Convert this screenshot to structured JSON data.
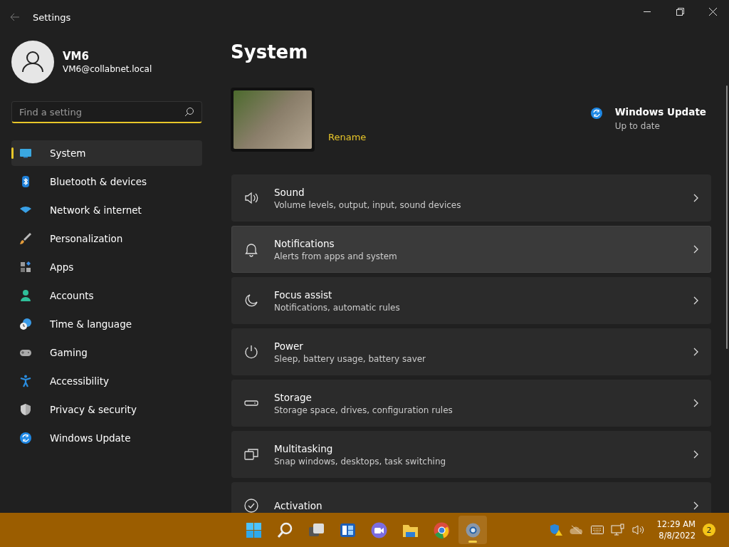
{
  "window": {
    "title": "Settings"
  },
  "profile": {
    "name": "VM6",
    "email": "VM6@collabnet.local"
  },
  "search": {
    "placeholder": "Find a setting"
  },
  "sidebar": {
    "items": [
      {
        "label": "System",
        "selected": true
      },
      {
        "label": "Bluetooth & devices",
        "selected": false
      },
      {
        "label": "Network & internet",
        "selected": false
      },
      {
        "label": "Personalization",
        "selected": false
      },
      {
        "label": "Apps",
        "selected": false
      },
      {
        "label": "Accounts",
        "selected": false
      },
      {
        "label": "Time & language",
        "selected": false
      },
      {
        "label": "Gaming",
        "selected": false
      },
      {
        "label": "Accessibility",
        "selected": false
      },
      {
        "label": "Privacy & security",
        "selected": false
      },
      {
        "label": "Windows Update",
        "selected": false
      }
    ]
  },
  "page": {
    "title": "System",
    "rename": "Rename",
    "update": {
      "title": "Windows Update",
      "status": "Up to date"
    }
  },
  "cards": [
    {
      "title": "Sound",
      "description": "Volume levels, output, input, sound devices",
      "hovered": false
    },
    {
      "title": "Notifications",
      "description": "Alerts from apps and system",
      "hovered": true
    },
    {
      "title": "Focus assist",
      "description": "Notifications, automatic rules",
      "hovered": false
    },
    {
      "title": "Power",
      "description": "Sleep, battery usage, battery saver",
      "hovered": false
    },
    {
      "title": "Storage",
      "description": "Storage space, drives, configuration rules",
      "hovered": false
    },
    {
      "title": "Multitasking",
      "description": "Snap windows, desktops, task switching",
      "hovered": false
    },
    {
      "title": "Activation",
      "hovered": false
    }
  ],
  "taskbar": {
    "apps": [
      {
        "kind": "start",
        "active": false
      },
      {
        "kind": "search",
        "active": false
      },
      {
        "kind": "taskview",
        "active": false
      },
      {
        "kind": "widgets",
        "active": false
      },
      {
        "kind": "chat",
        "active": false
      },
      {
        "kind": "explorer",
        "active": false
      },
      {
        "kind": "browser",
        "active": false
      },
      {
        "kind": "settings",
        "active": true
      }
    ],
    "time": "12:29 AM",
    "date": "8/8/2022",
    "notifications": "2"
  }
}
